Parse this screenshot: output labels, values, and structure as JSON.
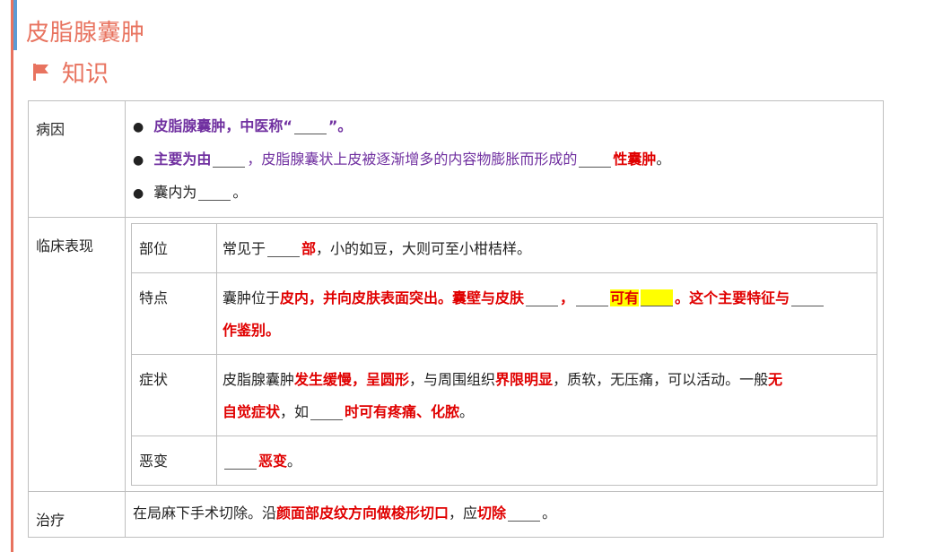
{
  "page_title": "皮脂腺囊肿",
  "section": {
    "icon": "flag-icon",
    "title": "知识"
  },
  "colors": {
    "accent": "#e8735f",
    "purple": "#7030a0",
    "red": "#e00000",
    "highlight": "#ffff00",
    "bar": "#5b9bd5"
  },
  "rows": {
    "cause": {
      "label": "病因",
      "line1": {
        "a": "皮脂腺囊肿，中医称“",
        "b": "”。"
      },
      "line2": {
        "a": "主要为由",
        "b": "，皮脂腺囊状上皮被逐渐增多的内容物膨胀而形成的",
        "c": "性囊肿",
        "d": "。"
      },
      "line3": {
        "a": "囊内为",
        "b": "。"
      }
    },
    "clinical": {
      "label": "临床表现",
      "site": {
        "label": "部位",
        "a": "常见于",
        "b": "部",
        "c": "，小的如豆，大则可至小柑桔样。"
      },
      "feature": {
        "label": "特点",
        "a": "囊肿位于",
        "b": "皮内，并向皮肤表面突出。囊壁与皮肤",
        "c": "，",
        "d": "可有",
        "e": "。这个主要特征与",
        "f": "作鉴别。"
      },
      "symptom": {
        "label": "症状",
        "a": " 皮脂腺囊肿",
        "b": "发生缓慢，呈圆形",
        "c": "，与周围组织",
        "d": "界限明显",
        "e": "，质软，无压痛，可以活动。一般",
        "f": "无",
        "g": "自觉症状",
        "h": "，如",
        "i": "时可有疼痛、化脓",
        "j": "。"
      },
      "malignant": {
        "label": "恶变",
        "a": "恶变",
        "b": "。"
      }
    },
    "treatment": {
      "label": "治疗",
      "a": "在局麻下手术切除。沿",
      "b": "颜面部皮纹方向做梭形切口",
      "c": "，应",
      "d": "切除",
      "e": "。"
    }
  }
}
